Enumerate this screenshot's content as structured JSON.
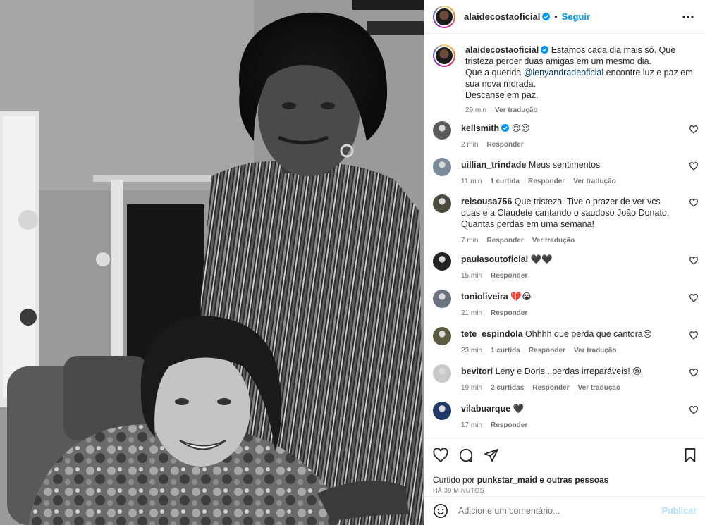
{
  "post": {
    "username": "alaidecostaoficial",
    "separator": "•",
    "follow_label": "Seguir",
    "caption": {
      "username": "alaidecostaoficial",
      "line1": "Estamos cada dia mais só. Que tristeza perder duas amigas em um mesmo dia.",
      "line2_pre": "Que a querida ",
      "mention": "@lenyandradeoficial",
      "line2_post": " encontre luz e paz em sua nova morada.",
      "line3": "Descanse em paz.",
      "time": "29 min",
      "translate": "Ver tradução"
    }
  },
  "comments": [
    {
      "user": "kellsmith",
      "verified": true,
      "text": "😌😌",
      "time": "2 min",
      "likes": "",
      "reply": "Responder",
      "translate": "",
      "avatar_color": "#5a5a5a"
    },
    {
      "user": "uillian_trindade",
      "verified": false,
      "text": "Meus sentimentos",
      "time": "11 min",
      "likes": "1 curtida",
      "reply": "Responder",
      "translate": "Ver tradução",
      "avatar_color": "#7b8a9a"
    },
    {
      "user": "reisousa756",
      "verified": false,
      "text": "Que tristeza. Tive o prazer de ver vcs duas e a Claudete cantando o saudoso João Donato. Quantas perdas em uma semana!",
      "time": "7 min",
      "likes": "",
      "reply": "Responder",
      "translate": "Ver tradução",
      "avatar_color": "#4a4a3e"
    },
    {
      "user": "paulasoutoficial",
      "verified": false,
      "text": "🖤🖤",
      "time": "15 min",
      "likes": "",
      "reply": "Responder",
      "translate": "",
      "avatar_color": "#222222"
    },
    {
      "user": "tonioliveira",
      "verified": false,
      "text": "💔😭",
      "time": "21 min",
      "likes": "",
      "reply": "Responder",
      "translate": "",
      "avatar_color": "#6a7480"
    },
    {
      "user": "tete_espindola",
      "verified": false,
      "text": "Ohhhh que perda que cantora😢",
      "time": "23 min",
      "likes": "1 curtida",
      "reply": "Responder",
      "translate": "Ver tradução",
      "avatar_color": "#5c5a40"
    },
    {
      "user": "bevitori",
      "verified": false,
      "text": "Leny e Doris...perdas irreparáveis! 😢",
      "time": "19 min",
      "likes": "2 curtidas",
      "reply": "Responder",
      "translate": "Ver tradução",
      "avatar_color": "#c9c9c9"
    },
    {
      "user": "vilabuarque",
      "verified": false,
      "text": "🖤",
      "time": "17 min",
      "likes": "",
      "reply": "Responder",
      "translate": "",
      "avatar_color": "#1f3a66"
    }
  ],
  "likes_line": {
    "prefix": "Curtido por ",
    "user": "punkstar_maid",
    "suffix": " e outras pessoas"
  },
  "posted_ago": "HÁ 30 MINUTOS",
  "comment_box": {
    "placeholder": "Adicione um comentário...",
    "publish": "Publicar"
  },
  "colors": {
    "accent": "#0095f6",
    "verified": "#0095f6",
    "muted": "#737373",
    "mention": "#00376b"
  }
}
